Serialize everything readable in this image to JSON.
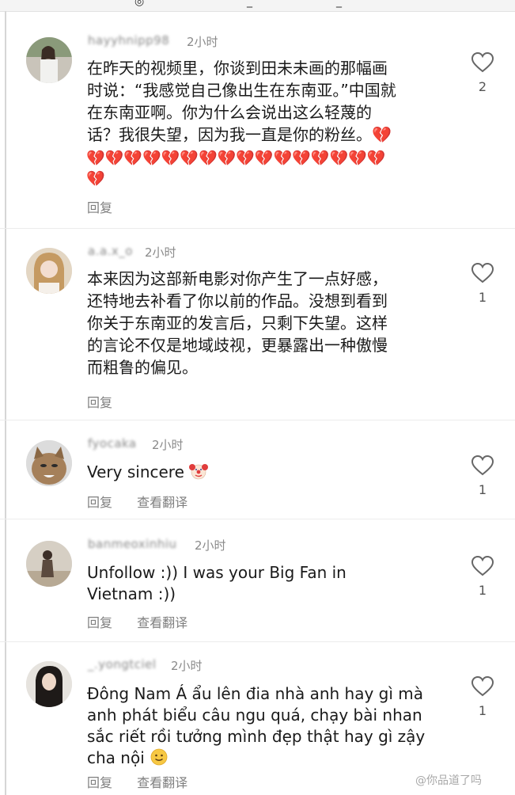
{
  "top_bar": {
    "glyph_left": "",
    "glyph_circle": "◎",
    "glyph_mid": "_",
    "glyph_mid2": "_"
  },
  "actions": {
    "reply": "回复",
    "translate": "查看翻译"
  },
  "comments": [
    {
      "username": "hayyhnipp98",
      "time": "2小时",
      "lines": [
        "在昨天的视频里，你谈到田未未画的那幅画",
        "时说：“我感觉自己像出生在东南亚。”中国就",
        "在东南亚啊。你为什么会说出这么轻蔑的",
        "话？我很失望，因为我一直是你的粉丝。💔"
      ],
      "hearts_line1": "💔💔💔💔💔💔💔💔💔💔💔💔💔💔💔💔",
      "hearts_line2": "💔",
      "likes": "2",
      "has_translate": false
    },
    {
      "username": "a.a.x_o",
      "time": "2小时",
      "lines": [
        "本来因为这部新电影对你产生了一点好感，",
        "还特地去补看了你以前的作品。没想到看到",
        "你关于东南亚的发言后，只剩下失望。这样",
        "的言论不仅是地域歧视，更暴露出一种傲慢",
        "而粗鲁的偏见。"
      ],
      "likes": "1",
      "has_translate": false
    },
    {
      "username": "fyocaka",
      "time": "2小时",
      "lines": [
        "Very sincere"
      ],
      "likes": "1",
      "has_translate": true
    },
    {
      "username": "banmeoxinhiu",
      "time": "2小时",
      "lines": [
        "Unfollow :)) I was your Big Fan in",
        "Vietnam :))"
      ],
      "likes": "1",
      "has_translate": true
    },
    {
      "username": "_.yongtciel",
      "time": "2小时",
      "lines": [
        "Đông Nam Á ẩu lên đia nhà anh hay gì mà",
        "anh phát biểu câu ngu quá, chạy bài nhan",
        "sắc riết rồi tưởng mình đẹp thật hay gì zậy",
        "cha nội"
      ],
      "likes": "1",
      "has_translate": true
    }
  ],
  "watermark": "@你品道了吗",
  "colors": {
    "heart_red": "#d9283a",
    "text_gray": "#7f7f7f"
  }
}
